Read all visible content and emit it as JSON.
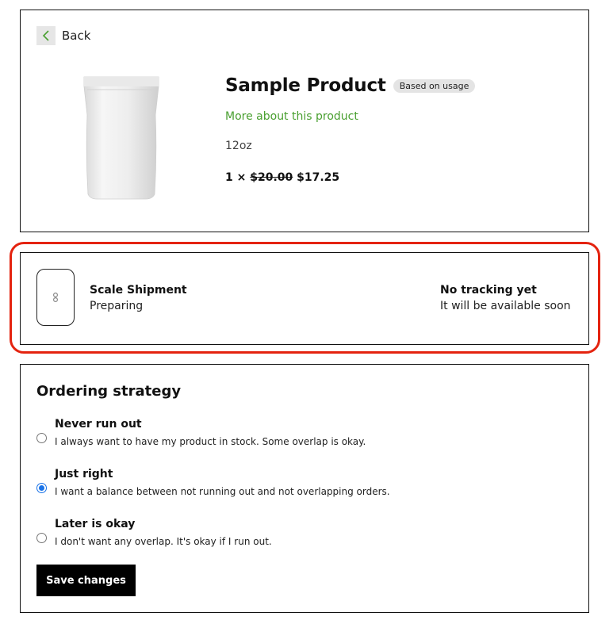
{
  "product": {
    "back_label": "Back",
    "title": "Sample Product",
    "badge": "Based on usage",
    "more_link": "More about this product",
    "size": "12oz",
    "quantity": "1 ×",
    "price_original": "$20.00",
    "price_current": "$17.25"
  },
  "shipment": {
    "title": "Scale Shipment",
    "status": "Preparing",
    "tracking_title": "No tracking yet",
    "tracking_sub": "It will be available soon",
    "highlight_color": "#e4230f"
  },
  "strategy": {
    "heading": "Ordering strategy",
    "options": [
      {
        "title": "Never run out",
        "desc": "I always want to have my product in stock. Some overlap is okay.",
        "checked": false
      },
      {
        "title": "Just right",
        "desc": "I want a balance between not running out and not overlapping orders.",
        "checked": true
      },
      {
        "title": "Later is okay",
        "desc": "I don't want any overlap. It's okay if I run out.",
        "checked": false
      }
    ],
    "save_label": "Save changes"
  },
  "colors": {
    "accent_green": "#4aa031",
    "radio_blue": "#1a73e8",
    "button_bg": "#000000"
  }
}
